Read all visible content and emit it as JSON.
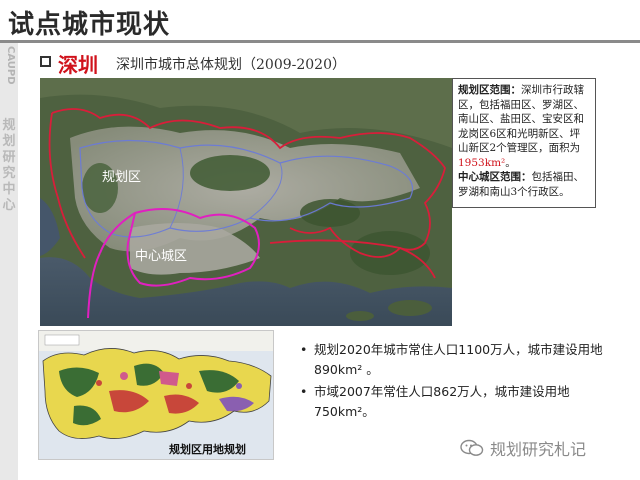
{
  "header": {
    "title": "试点城市现状"
  },
  "sidebar": {
    "logo_text": "CAUPD",
    "org_chars": [
      "规",
      "划",
      "研",
      "究",
      "中",
      "心"
    ]
  },
  "section": {
    "city": "深圳",
    "plan_title": "深圳市城市总体规划（2009-2020）"
  },
  "map": {
    "label_planning_area": "规划区",
    "label_central_area": "中心城区"
  },
  "info": {
    "planning_heading": "规划区范围：",
    "planning_text": "深圳市行政辖区，包括福田区、罗湖区、南山区、盐田区、宝安区和龙岗区6区和光明新区、坪山新区2个管理区，面积为",
    "planning_area_value": "1953km²",
    "planning_end": "。",
    "central_heading": "中心城区范围：",
    "central_text": "包括福田、罗湖和南山3个行政区。"
  },
  "land_map": {
    "caption": "规划区用地规划"
  },
  "bullets": [
    "规划2020年城市常住人口1100万人，城市建设用地890km² 。",
    "市域2007年常住人口862万人，城市建设用地750km²。"
  ],
  "watermark": {
    "text": "规划研究札记"
  },
  "colors": {
    "accent_red": "#d0121b",
    "planning_boundary": "#d81e3a",
    "central_boundary": "#e020c0",
    "district_boundary": "#6a7ad8"
  }
}
